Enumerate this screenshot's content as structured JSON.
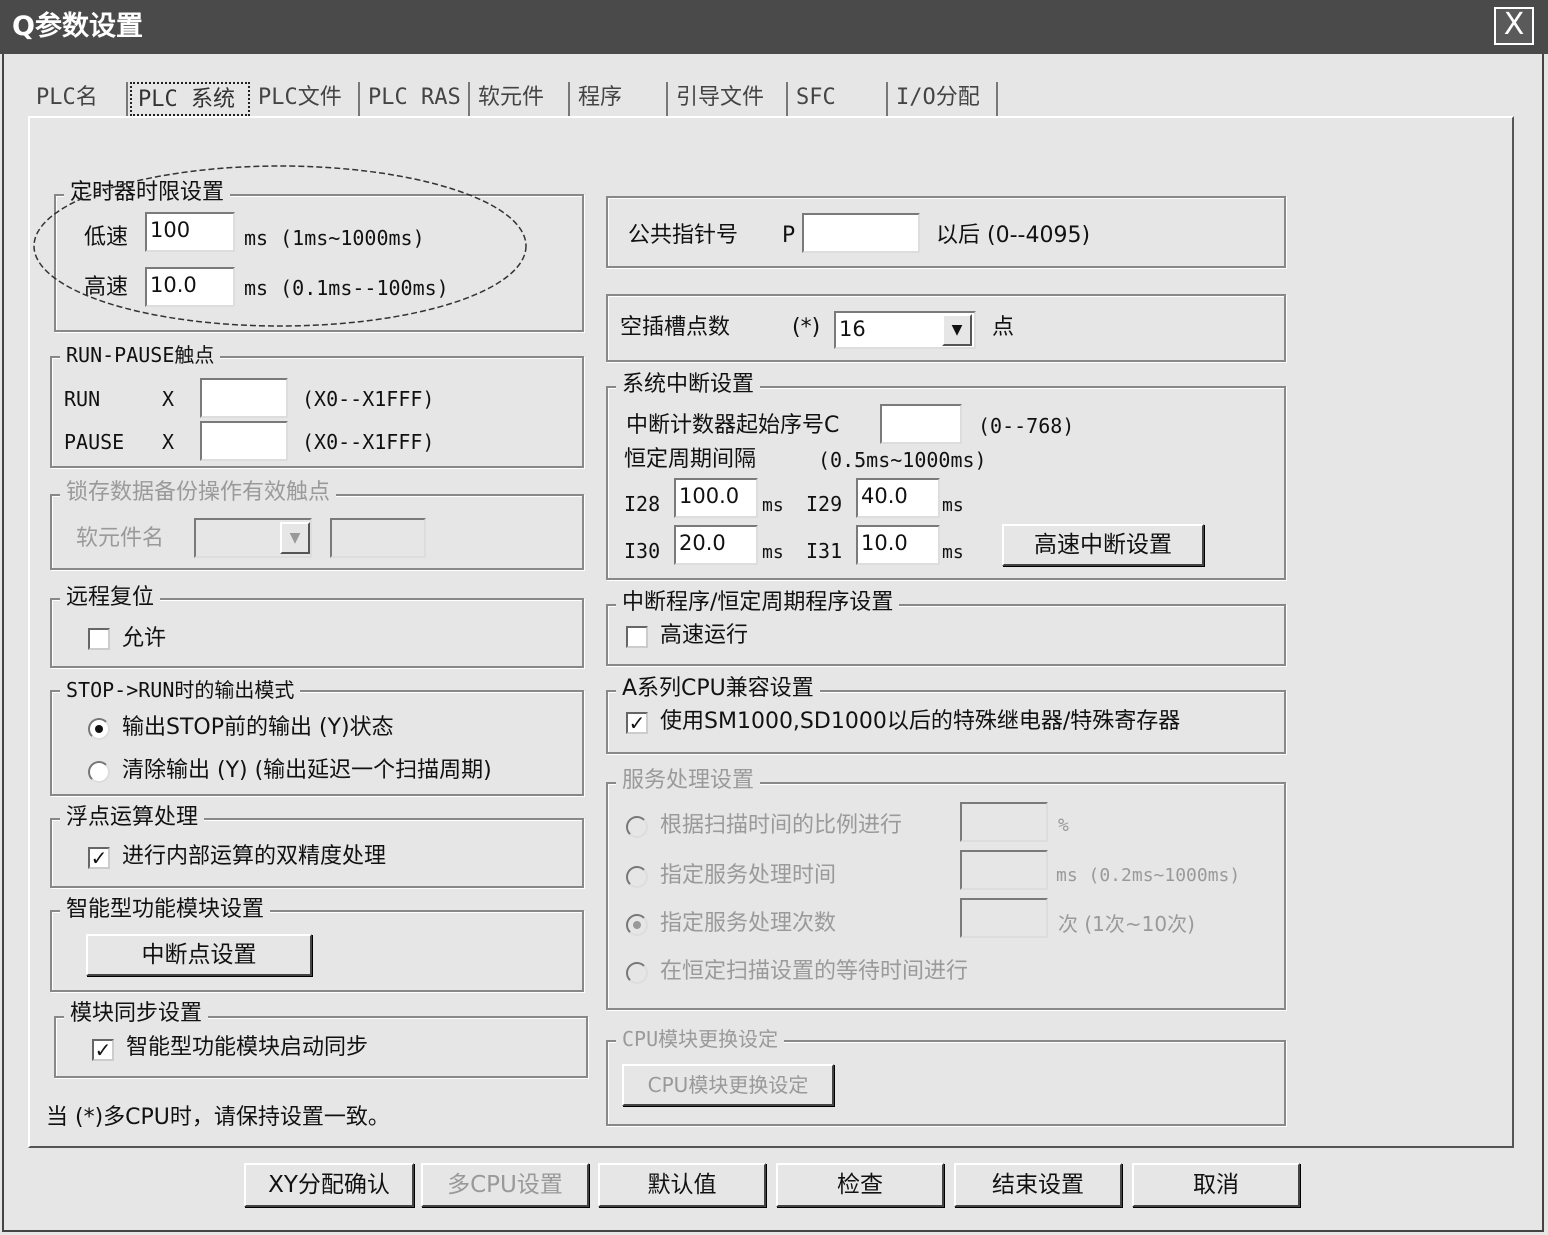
{
  "window": {
    "title": "Q参数设置",
    "close_label": "X"
  },
  "tabs": [
    {
      "label": "PLC名"
    },
    {
      "label": "PLC 系统"
    },
    {
      "label": "PLC文件"
    },
    {
      "label": "PLC RAS"
    },
    {
      "label": "软元件"
    },
    {
      "label": "程序"
    },
    {
      "label": "引导文件"
    },
    {
      "label": "SFC"
    },
    {
      "label": "I/O分配"
    }
  ],
  "timer": {
    "title": "定时器时限设置",
    "low_label": "低速",
    "low_value": "100",
    "low_range": "ms (1ms~1000ms)",
    "high_label": "高速",
    "high_value": "10.0",
    "high_range": "ms (0.1ms--100ms)"
  },
  "run_pause": {
    "title": "RUN-PAUSE触点",
    "run_label": "RUN",
    "pause_label": "PAUSE",
    "x_label": "X",
    "run_value": "",
    "pause_value": "",
    "range": "(X0--X1FFF)"
  },
  "latch": {
    "title": "锁存数据备份操作有效触点",
    "device_label": "软元件名"
  },
  "remote_reset": {
    "title": "远程复位",
    "allow_label": "允许",
    "allow_checked": false
  },
  "stop_run": {
    "title": "STOP->RUN时的输出模式",
    "opt1": "输出STOP前的输出 (Y)状态",
    "opt2": "清除输出 (Y) (输出延迟一个扫描周期)",
    "selected": 1
  },
  "float": {
    "title": "浮点运算处理",
    "opt": "进行内部运算的双精度处理",
    "checked": true
  },
  "intelligent": {
    "title": "智能型功能模块设置",
    "button": "中断点设置"
  },
  "sync": {
    "title": "模块同步设置",
    "opt": "智能型功能模块启动同步",
    "checked": true
  },
  "note": "当 (*)多CPU时，请保持设置一致。",
  "pointer": {
    "label": "公共指针号",
    "p": "P",
    "value": "",
    "range": "以后 (0--4095)"
  },
  "empty_slot": {
    "label": "空插槽点数",
    "star": "(*)",
    "value": "16",
    "unit": "点"
  },
  "interrupt": {
    "title": "系统中断设置",
    "counter_label": "中断计数器起始序号C",
    "counter_value": "",
    "counter_range": "(0--768)",
    "period_label": "恒定周期间隔",
    "period_range": "(0.5ms~1000ms)",
    "i28": "I28",
    "i28_value": "100.0",
    "i29": "I29",
    "i29_value": "40.0",
    "i30": "I30",
    "i30_value": "20.0",
    "i31": "I31",
    "i31_value": "10.0",
    "ms": "ms",
    "button": "高速中断设置"
  },
  "int_program": {
    "title": "中断程序/恒定周期程序设置",
    "opt": "高速运行",
    "checked": false
  },
  "a_series": {
    "title": "A系列CPU兼容设置",
    "opt": "使用SM1000,SD1000以后的特殊继电器/特殊寄存器",
    "checked": true
  },
  "service": {
    "title": "服务处理设置",
    "opt1": "根据扫描时间的比例进行",
    "unit1": "%",
    "opt2": "指定服务处理时间",
    "unit2": "ms (0.2ms~1000ms)",
    "opt3": "指定服务处理次数",
    "unit3": "次 (1次~10次)",
    "opt4": "在恒定扫描设置的等待时间进行",
    "selected": 3
  },
  "cpu_replace": {
    "title": "CPU模块更换设定",
    "button": "CPU模块更换设定"
  },
  "buttons": {
    "xy": "XY分配确认",
    "multi": "多CPU设置",
    "default": "默认值",
    "check": "检查",
    "finish": "结束设置",
    "cancel": "取消"
  }
}
